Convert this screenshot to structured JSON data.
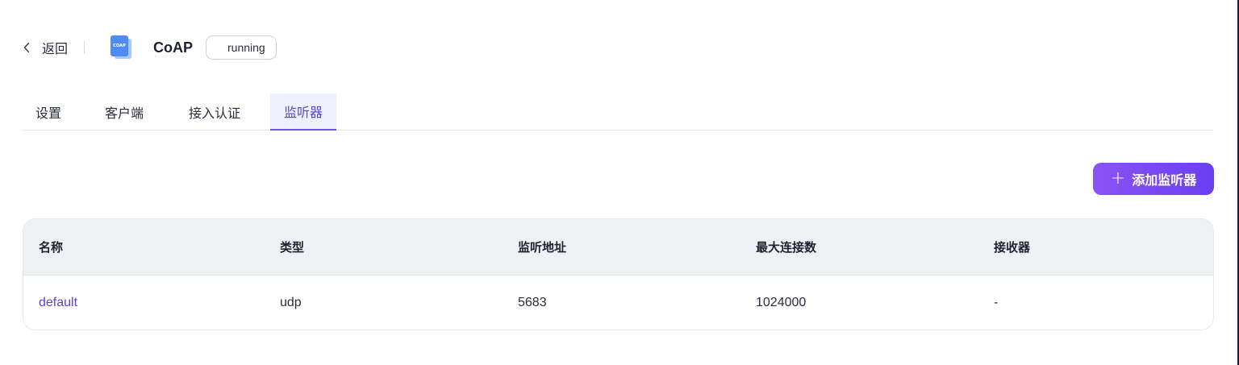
{
  "header": {
    "back_label": "返回",
    "logo_text": "COAP",
    "title": "CoAP",
    "status": "running"
  },
  "tabs": [
    {
      "label": "设置",
      "active": false
    },
    {
      "label": "客户端",
      "active": false
    },
    {
      "label": "接入认证",
      "active": false
    },
    {
      "label": "监听器",
      "active": true
    }
  ],
  "add_button": {
    "icon": "plus-icon",
    "label": "添加监听器"
  },
  "table": {
    "columns": [
      "名称",
      "类型",
      "监听地址",
      "最大连接数",
      "接收器"
    ],
    "rows": [
      [
        "default",
        "udp",
        "5683",
        "1024000",
        "-"
      ]
    ]
  },
  "colors": {
    "accent": "#6a52e6",
    "button_start": "#8a53f4",
    "button_end": "#6a3ff0",
    "link": "#5b3fe0"
  }
}
